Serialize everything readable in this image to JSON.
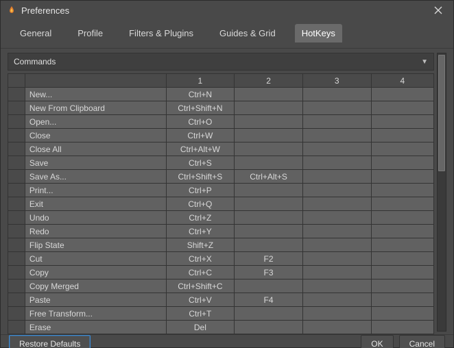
{
  "window": {
    "title": "Preferences"
  },
  "tabs": [
    {
      "label": "General"
    },
    {
      "label": "Profile"
    },
    {
      "label": "Filters & Plugins"
    },
    {
      "label": "Guides & Grid"
    },
    {
      "label": "HotKeys"
    }
  ],
  "active_tab": "HotKeys",
  "section": {
    "title": "Commands"
  },
  "columns": {
    "c1": "1",
    "c2": "2",
    "c3": "3",
    "c4": "4"
  },
  "rows": [
    {
      "cmd": "New...",
      "k1": "Ctrl+N",
      "k2": "",
      "k3": "",
      "k4": ""
    },
    {
      "cmd": "New From Clipboard",
      "k1": "Ctrl+Shift+N",
      "k2": "",
      "k3": "",
      "k4": ""
    },
    {
      "cmd": "Open...",
      "k1": "Ctrl+O",
      "k2": "",
      "k3": "",
      "k4": ""
    },
    {
      "cmd": "Close",
      "k1": "Ctrl+W",
      "k2": "",
      "k3": "",
      "k4": ""
    },
    {
      "cmd": "Close All",
      "k1": "Ctrl+Alt+W",
      "k2": "",
      "k3": "",
      "k4": ""
    },
    {
      "cmd": "Save",
      "k1": "Ctrl+S",
      "k2": "",
      "k3": "",
      "k4": ""
    },
    {
      "cmd": "Save As...",
      "k1": "Ctrl+Shift+S",
      "k2": "Ctrl+Alt+S",
      "k3": "",
      "k4": ""
    },
    {
      "cmd": "Print...",
      "k1": "Ctrl+P",
      "k2": "",
      "k3": "",
      "k4": ""
    },
    {
      "cmd": "Exit",
      "k1": "Ctrl+Q",
      "k2": "",
      "k3": "",
      "k4": ""
    },
    {
      "cmd": "Undo",
      "k1": "Ctrl+Z",
      "k2": "",
      "k3": "",
      "k4": ""
    },
    {
      "cmd": "Redo",
      "k1": "Ctrl+Y",
      "k2": "",
      "k3": "",
      "k4": ""
    },
    {
      "cmd": "Flip State",
      "k1": "Shift+Z",
      "k2": "",
      "k3": "",
      "k4": ""
    },
    {
      "cmd": "Cut",
      "k1": "Ctrl+X",
      "k2": "F2",
      "k3": "",
      "k4": ""
    },
    {
      "cmd": "Copy",
      "k1": "Ctrl+C",
      "k2": "F3",
      "k3": "",
      "k4": ""
    },
    {
      "cmd": "Copy Merged",
      "k1": "Ctrl+Shift+C",
      "k2": "",
      "k3": "",
      "k4": ""
    },
    {
      "cmd": "Paste",
      "k1": "Ctrl+V",
      "k2": "F4",
      "k3": "",
      "k4": ""
    },
    {
      "cmd": "Free Transform...",
      "k1": "Ctrl+T",
      "k2": "",
      "k3": "",
      "k4": ""
    },
    {
      "cmd": "Erase",
      "k1": "Del",
      "k2": "",
      "k3": "",
      "k4": ""
    }
  ],
  "footer": {
    "restore": "Restore Defaults",
    "ok": "OK",
    "cancel": "Cancel"
  }
}
